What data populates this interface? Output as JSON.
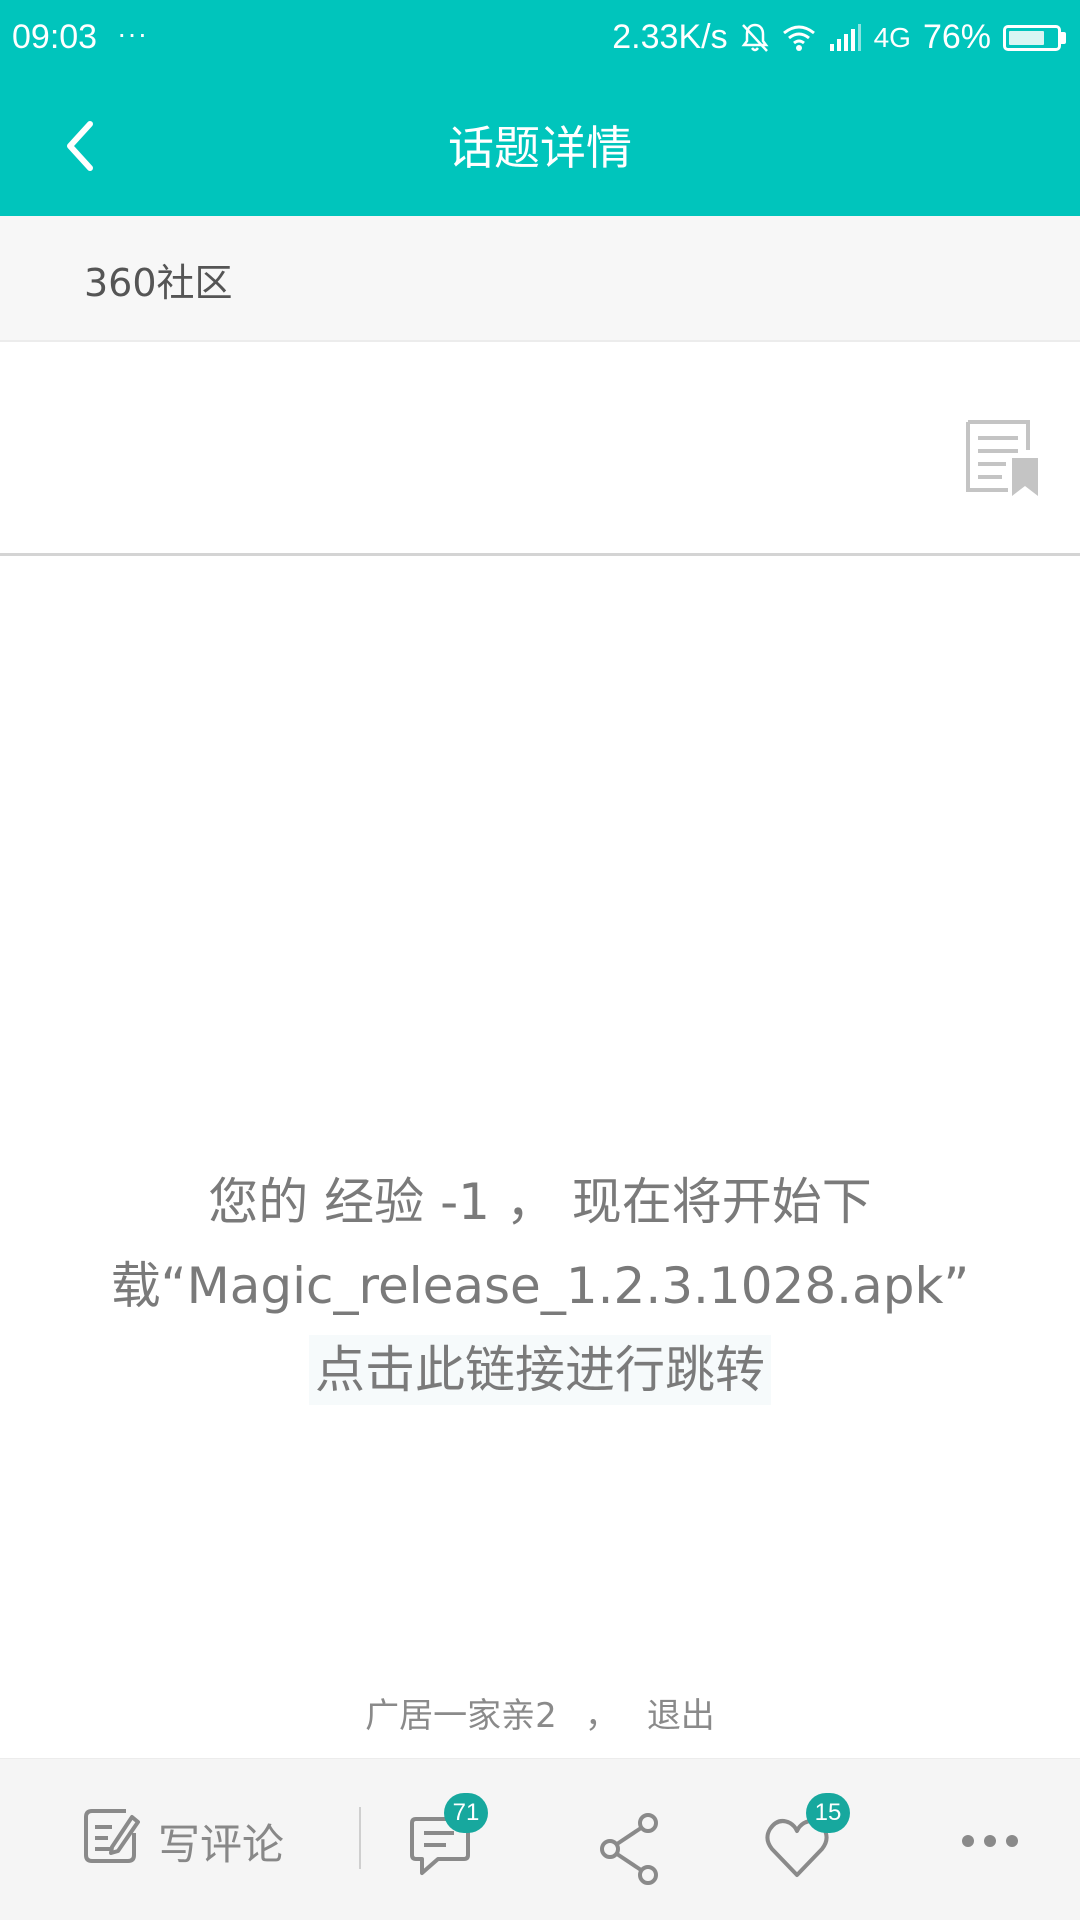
{
  "status_bar": {
    "time": "09:03",
    "dots": "···",
    "network_speed": "2.33K/s",
    "network_type": "4G",
    "battery_percent": "76%",
    "battery_level": 0.76,
    "icons": [
      "bell-muted-icon",
      "wifi-icon",
      "signal-icon",
      "battery-icon"
    ]
  },
  "header": {
    "title": "话题详情",
    "back_icon": "chevron-left-icon",
    "background_color": "#00c5bc"
  },
  "community": {
    "name": "360社区"
  },
  "title_area": {
    "bookmark_icon": "article-bookmark-icon"
  },
  "message": {
    "line1": "您的 经验 -1 ， 现在将开始下",
    "line2": "载“Magic_release_1.2.3.1028.apk”",
    "link": "点击此链接进行跳转"
  },
  "user_footer": {
    "username": "广居一家亲2",
    "separator": "，",
    "logout": "退出"
  },
  "bottom_bar": {
    "write_comment_label": "写评论",
    "comment_count": "71",
    "like_count": "15",
    "icons": [
      "edit-icon",
      "comment-icon",
      "share-icon",
      "heart-icon",
      "more-icon"
    ],
    "badge_color": "#17a89e"
  }
}
